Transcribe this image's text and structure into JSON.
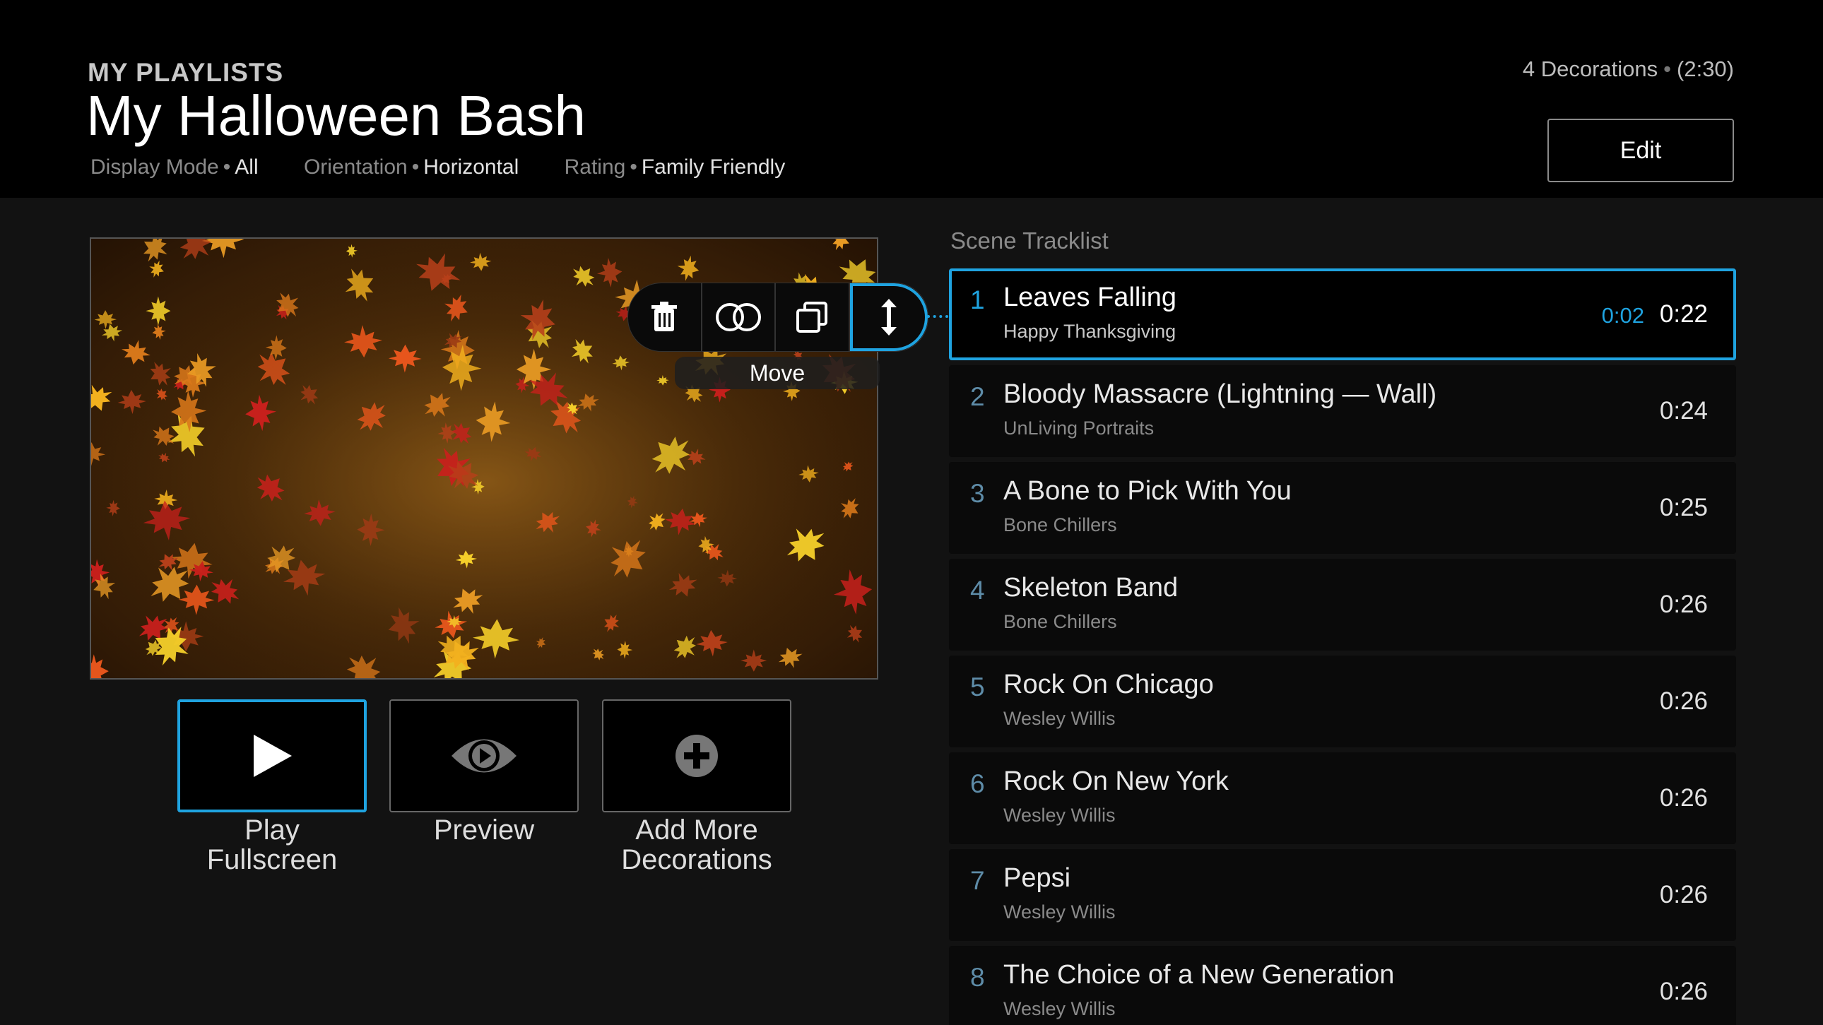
{
  "header": {
    "eyebrow": "MY PLAYLISTS",
    "title": "My Halloween Bash",
    "meta": [
      {
        "key": "Display Mode",
        "value": "All"
      },
      {
        "key": "Orientation",
        "value": "Horizontal"
      },
      {
        "key": "Rating",
        "value": "Family Friendly"
      }
    ],
    "summary_count": "4 Decorations",
    "summary_duration": "(2:30)",
    "edit_label": "Edit"
  },
  "preview": {
    "toolbar": [
      {
        "icon": "trash-icon"
      },
      {
        "icon": "transition-icon"
      },
      {
        "icon": "duplicate-icon"
      },
      {
        "icon": "move-vertical-icon",
        "active": true
      }
    ],
    "active_tool_label": "Move"
  },
  "actions": [
    {
      "label_line1": "Play",
      "label_line2": "Fullscreen",
      "icon": "play-icon",
      "selected": true
    },
    {
      "label_line1": "Preview",
      "label_line2": "",
      "icon": "eye-icon"
    },
    {
      "label_line1": "Add More",
      "label_line2": "Decorations",
      "icon": "add-circle-icon"
    }
  ],
  "tracklist": {
    "title": "Scene Tracklist",
    "tracks": [
      {
        "num": "1",
        "title": "Leaves Falling",
        "sub": "Happy Thanksgiving",
        "elapsed": "0:02",
        "duration": "0:22"
      },
      {
        "num": "2",
        "title": "Bloody Massacre (Lightning — Wall)",
        "sub": "UnLiving Portraits",
        "duration": "0:24"
      },
      {
        "num": "3",
        "title": "A Bone to Pick With You",
        "sub": "Bone Chillers",
        "duration": "0:25"
      },
      {
        "num": "4",
        "title": "Skeleton Band",
        "sub": "Bone Chillers",
        "duration": "0:26"
      },
      {
        "num": "5",
        "title": "Rock On Chicago",
        "sub": "Wesley Willis",
        "duration": "0:26"
      },
      {
        "num": "6",
        "title": "Rock On New York",
        "sub": "Wesley Willis",
        "duration": "0:26"
      },
      {
        "num": "7",
        "title": "Pepsi",
        "sub": "Wesley Willis",
        "duration": "0:26"
      },
      {
        "num": "8",
        "title": "The Choice of a New Generation",
        "sub": "Wesley Willis",
        "duration": "0:26"
      }
    ]
  },
  "colors": {
    "accent": "#1fa3e0",
    "background": "#121212",
    "header": "#000000"
  }
}
